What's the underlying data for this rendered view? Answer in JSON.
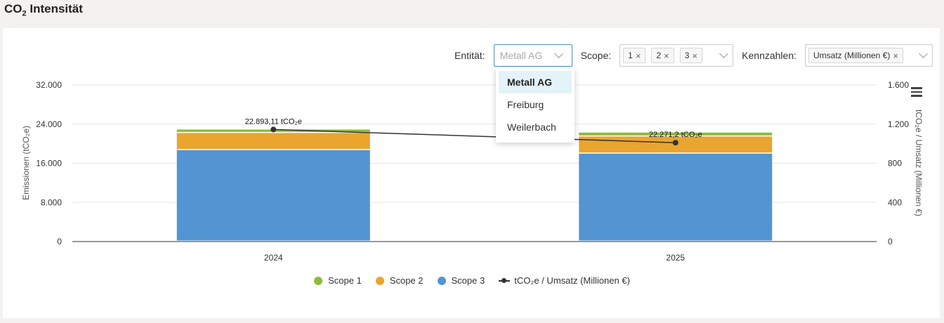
{
  "title": {
    "main": "CO",
    "sub": "2",
    "rest": " Intensität"
  },
  "filters": {
    "entity_label": "Entität:",
    "entity_value": "Metall AG",
    "entity_options": [
      "Metall AG",
      "Freiburg",
      "Weilerbach"
    ],
    "scope_label": "Scope:",
    "scope_tags": [
      "1",
      "2",
      "3"
    ],
    "kpi_label": "Kennzahlen:",
    "kpi_tag": "Umsatz (Millionen €)"
  },
  "colors": {
    "scope1": "#8bbd3a",
    "scope2": "#eaa52f",
    "scope3": "#5394d3",
    "line": "#333333"
  },
  "chart_data": {
    "type": "bar",
    "stacked": true,
    "categories": [
      "2024",
      "2025"
    ],
    "series": [
      {
        "name": "Scope 1",
        "values": [
          700,
          800
        ]
      },
      {
        "name": "Scope 2",
        "values": [
          3500,
          3500
        ]
      },
      {
        "name": "Scope 3",
        "values": [
          18693.11,
          17971.2
        ]
      }
    ],
    "line_series": {
      "name": "tCO₂e / Umsatz (Millionen €)",
      "values": [
        1145,
        1010
      ],
      "axis": "right"
    },
    "data_labels": [
      "22.893,11 tCO₂e",
      "22.271,2 tCO₂e"
    ],
    "ylabel_left": "Emissionen (tCO₂e)",
    "ylabel_right": "tCO₂e / Umsatz (Millionen €)",
    "ylim_left": [
      0,
      32000
    ],
    "ylim_right": [
      0,
      1600
    ],
    "yticks_left": [
      "0",
      "8.000",
      "16.000",
      "24.000",
      "32.000"
    ],
    "yticks_right": [
      "0",
      "400",
      "800",
      "1.200",
      "1.600"
    ],
    "grid": true,
    "legend_position": "bottom"
  },
  "legend": [
    "Scope 1",
    "Scope 2",
    "Scope 3",
    "tCO₂e / Umsatz (Millionen €)"
  ]
}
